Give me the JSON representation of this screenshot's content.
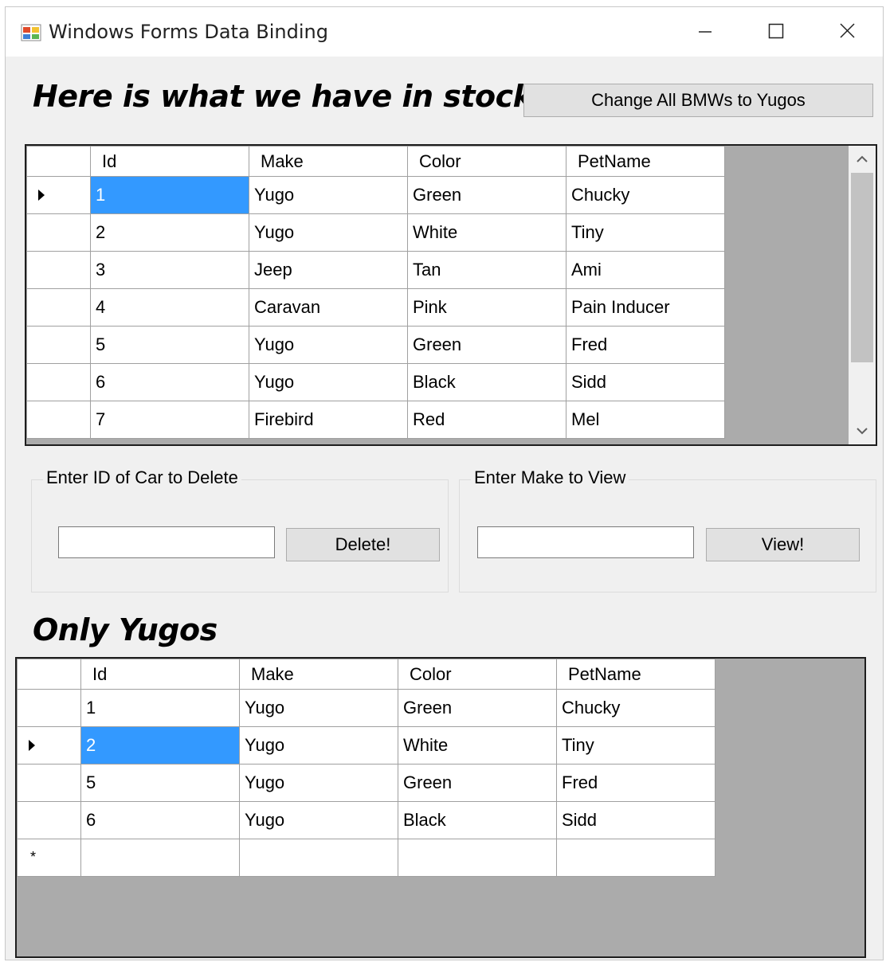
{
  "window": {
    "title": "Windows Forms Data Binding",
    "icon": "winforms-app-icon",
    "controls": [
      "minimize-icon",
      "maximize-icon",
      "close-icon"
    ]
  },
  "stock_section": {
    "heading": "Here is what we have in stock",
    "change_button_label": "Change All BMWs to Yugos"
  },
  "inventory_grid": {
    "columns": [
      "Id",
      "Make",
      "Color",
      "PetName"
    ],
    "rows": [
      {
        "id": "1",
        "make": "Yugo",
        "color": "Green",
        "petname": "Chucky",
        "current": true
      },
      {
        "id": "2",
        "make": "Yugo",
        "color": "White",
        "petname": "Tiny"
      },
      {
        "id": "3",
        "make": "Jeep",
        "color": "Tan",
        "petname": "Ami"
      },
      {
        "id": "4",
        "make": "Caravan",
        "color": "Pink",
        "petname": "Pain Inducer"
      },
      {
        "id": "5",
        "make": "Yugo",
        "color": "Green",
        "petname": "Fred"
      },
      {
        "id": "6",
        "make": "Yugo",
        "color": "Black",
        "petname": "Sidd"
      },
      {
        "id": "7",
        "make": "Firebird",
        "color": "Red",
        "petname": "Mel"
      }
    ]
  },
  "delete_group": {
    "legend": "Enter ID of Car to Delete",
    "input_value": "",
    "button_label": "Delete!"
  },
  "view_group": {
    "legend": "Enter Make to View",
    "input_value": "",
    "button_label": "View!"
  },
  "yugos_section": {
    "heading": "Only Yugos"
  },
  "yugos_grid": {
    "columns": [
      "Id",
      "Make",
      "Color",
      "PetName"
    ],
    "rows": [
      {
        "id": "1",
        "make": "Yugo",
        "color": "Green",
        "petname": "Chucky"
      },
      {
        "id": "2",
        "make": "Yugo",
        "color": "White",
        "petname": "Tiny",
        "current": true
      },
      {
        "id": "5",
        "make": "Yugo",
        "color": "Green",
        "petname": "Fred"
      },
      {
        "id": "6",
        "make": "Yugo",
        "color": "Black",
        "petname": "Sidd"
      }
    ],
    "new_row_marker": "*"
  },
  "colors": {
    "selection": "#3399ff",
    "grid_background": "#ababab",
    "form_background": "#f0f0f0",
    "button_face": "#e1e1e1"
  }
}
